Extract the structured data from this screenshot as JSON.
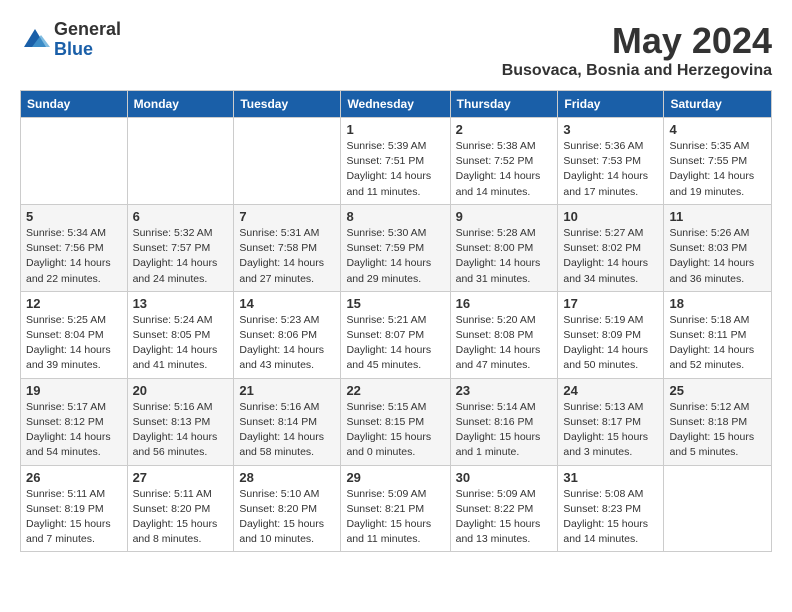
{
  "logo": {
    "general": "General",
    "blue": "Blue"
  },
  "title": "May 2024",
  "location": "Busovaca, Bosnia and Herzegovina",
  "days_header": [
    "Sunday",
    "Monday",
    "Tuesday",
    "Wednesday",
    "Thursday",
    "Friday",
    "Saturday"
  ],
  "weeks": [
    [
      {
        "day": "",
        "info": ""
      },
      {
        "day": "",
        "info": ""
      },
      {
        "day": "",
        "info": ""
      },
      {
        "day": "1",
        "info": "Sunrise: 5:39 AM\nSunset: 7:51 PM\nDaylight: 14 hours\nand 11 minutes."
      },
      {
        "day": "2",
        "info": "Sunrise: 5:38 AM\nSunset: 7:52 PM\nDaylight: 14 hours\nand 14 minutes."
      },
      {
        "day": "3",
        "info": "Sunrise: 5:36 AM\nSunset: 7:53 PM\nDaylight: 14 hours\nand 17 minutes."
      },
      {
        "day": "4",
        "info": "Sunrise: 5:35 AM\nSunset: 7:55 PM\nDaylight: 14 hours\nand 19 minutes."
      }
    ],
    [
      {
        "day": "5",
        "info": "Sunrise: 5:34 AM\nSunset: 7:56 PM\nDaylight: 14 hours\nand 22 minutes."
      },
      {
        "day": "6",
        "info": "Sunrise: 5:32 AM\nSunset: 7:57 PM\nDaylight: 14 hours\nand 24 minutes."
      },
      {
        "day": "7",
        "info": "Sunrise: 5:31 AM\nSunset: 7:58 PM\nDaylight: 14 hours\nand 27 minutes."
      },
      {
        "day": "8",
        "info": "Sunrise: 5:30 AM\nSunset: 7:59 PM\nDaylight: 14 hours\nand 29 minutes."
      },
      {
        "day": "9",
        "info": "Sunrise: 5:28 AM\nSunset: 8:00 PM\nDaylight: 14 hours\nand 31 minutes."
      },
      {
        "day": "10",
        "info": "Sunrise: 5:27 AM\nSunset: 8:02 PM\nDaylight: 14 hours\nand 34 minutes."
      },
      {
        "day": "11",
        "info": "Sunrise: 5:26 AM\nSunset: 8:03 PM\nDaylight: 14 hours\nand 36 minutes."
      }
    ],
    [
      {
        "day": "12",
        "info": "Sunrise: 5:25 AM\nSunset: 8:04 PM\nDaylight: 14 hours\nand 39 minutes."
      },
      {
        "day": "13",
        "info": "Sunrise: 5:24 AM\nSunset: 8:05 PM\nDaylight: 14 hours\nand 41 minutes."
      },
      {
        "day": "14",
        "info": "Sunrise: 5:23 AM\nSunset: 8:06 PM\nDaylight: 14 hours\nand 43 minutes."
      },
      {
        "day": "15",
        "info": "Sunrise: 5:21 AM\nSunset: 8:07 PM\nDaylight: 14 hours\nand 45 minutes."
      },
      {
        "day": "16",
        "info": "Sunrise: 5:20 AM\nSunset: 8:08 PM\nDaylight: 14 hours\nand 47 minutes."
      },
      {
        "day": "17",
        "info": "Sunrise: 5:19 AM\nSunset: 8:09 PM\nDaylight: 14 hours\nand 50 minutes."
      },
      {
        "day": "18",
        "info": "Sunrise: 5:18 AM\nSunset: 8:11 PM\nDaylight: 14 hours\nand 52 minutes."
      }
    ],
    [
      {
        "day": "19",
        "info": "Sunrise: 5:17 AM\nSunset: 8:12 PM\nDaylight: 14 hours\nand 54 minutes."
      },
      {
        "day": "20",
        "info": "Sunrise: 5:16 AM\nSunset: 8:13 PM\nDaylight: 14 hours\nand 56 minutes."
      },
      {
        "day": "21",
        "info": "Sunrise: 5:16 AM\nSunset: 8:14 PM\nDaylight: 14 hours\nand 58 minutes."
      },
      {
        "day": "22",
        "info": "Sunrise: 5:15 AM\nSunset: 8:15 PM\nDaylight: 15 hours\nand 0 minutes."
      },
      {
        "day": "23",
        "info": "Sunrise: 5:14 AM\nSunset: 8:16 PM\nDaylight: 15 hours\nand 1 minute."
      },
      {
        "day": "24",
        "info": "Sunrise: 5:13 AM\nSunset: 8:17 PM\nDaylight: 15 hours\nand 3 minutes."
      },
      {
        "day": "25",
        "info": "Sunrise: 5:12 AM\nSunset: 8:18 PM\nDaylight: 15 hours\nand 5 minutes."
      }
    ],
    [
      {
        "day": "26",
        "info": "Sunrise: 5:11 AM\nSunset: 8:19 PM\nDaylight: 15 hours\nand 7 minutes."
      },
      {
        "day": "27",
        "info": "Sunrise: 5:11 AM\nSunset: 8:20 PM\nDaylight: 15 hours\nand 8 minutes."
      },
      {
        "day": "28",
        "info": "Sunrise: 5:10 AM\nSunset: 8:20 PM\nDaylight: 15 hours\nand 10 minutes."
      },
      {
        "day": "29",
        "info": "Sunrise: 5:09 AM\nSunset: 8:21 PM\nDaylight: 15 hours\nand 11 minutes."
      },
      {
        "day": "30",
        "info": "Sunrise: 5:09 AM\nSunset: 8:22 PM\nDaylight: 15 hours\nand 13 minutes."
      },
      {
        "day": "31",
        "info": "Sunrise: 5:08 AM\nSunset: 8:23 PM\nDaylight: 15 hours\nand 14 minutes."
      },
      {
        "day": "",
        "info": ""
      }
    ]
  ]
}
